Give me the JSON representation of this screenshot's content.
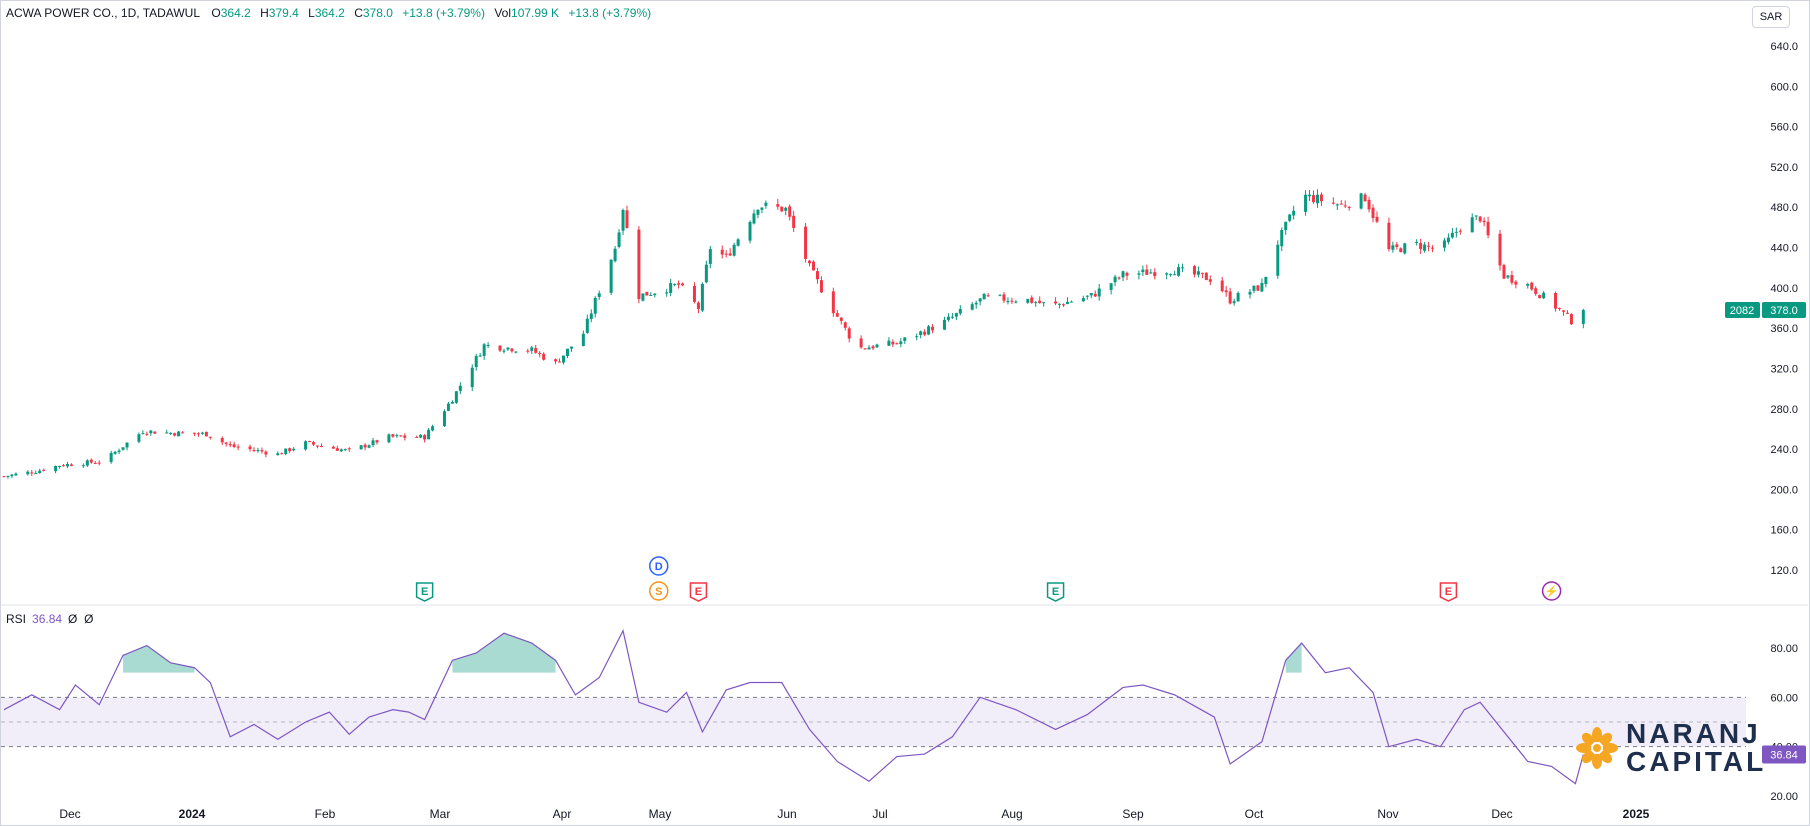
{
  "header": {
    "symbol": "ACWA POWER CO., 1D, TADAWUL",
    "open_label": "O",
    "open": "364.2",
    "high_label": "H",
    "high": "379.4",
    "low_label": "L",
    "low": "364.2",
    "close_label": "C",
    "close": "378.0",
    "change": "+13.8 (+3.79%)",
    "vol_label": "Vol",
    "vol": "107.99 K",
    "vol_change": "+13.8 (+3.79%)"
  },
  "currency": "SAR",
  "price_badges": {
    "countdown": "2082",
    "last": "378.0"
  },
  "rsi": {
    "label": "RSI",
    "value": "36.84",
    "extra1": "Ø",
    "extra2": "Ø"
  },
  "logo": {
    "line1": "NARANJ",
    "line2": "CAPITAL"
  },
  "colors": {
    "up": "#089981",
    "down": "#f23645",
    "rsi": "#7e57c2"
  },
  "chart_data": [
    {
      "type": "candlestick",
      "title": "ACWA POWER CO., 1D, TADAWUL",
      "x_tick_labels": [
        "Dec",
        "2024",
        "Feb",
        "Mar",
        "Apr",
        "May",
        "Jun",
        "Jul",
        "Aug",
        "Sep",
        "Oct",
        "Nov",
        "Dec",
        "2025"
      ],
      "y_tick_labels": [
        "640.0",
        "600.0",
        "560.0",
        "520.0",
        "480.0",
        "440.0",
        "400.0",
        "360.0",
        "320.0",
        "280.0",
        "240.0",
        "200.0",
        "160.0",
        "120.0"
      ],
      "ylim": [
        100,
        655
      ],
      "date_range": [
        "2023-11-20",
        "2024-12-01"
      ],
      "close_path": [
        {
          "t": "2023-11-20",
          "v": 213
        },
        {
          "t": "2023-11-28",
          "v": 218
        },
        {
          "t": "2023-12-04",
          "v": 224
        },
        {
          "t": "2023-12-15",
          "v": 228
        },
        {
          "t": "2023-12-25",
          "v": 258
        },
        {
          "t": "2024-01-01",
          "v": 256
        },
        {
          "t": "2024-01-10",
          "v": 255
        },
        {
          "t": "2024-01-16",
          "v": 243
        },
        {
          "t": "2024-01-28",
          "v": 235
        },
        {
          "t": "2024-02-04",
          "v": 246
        },
        {
          "t": "2024-02-15",
          "v": 238
        },
        {
          "t": "2024-02-25",
          "v": 252
        },
        {
          "t": "2024-03-05",
          "v": 252
        },
        {
          "t": "2024-03-12",
          "v": 290
        },
        {
          "t": "2024-03-20",
          "v": 343
        },
        {
          "t": "2024-04-01",
          "v": 338
        },
        {
          "t": "2024-04-07",
          "v": 325
        },
        {
          "t": "2024-04-14",
          "v": 355
        },
        {
          "t": "2024-04-22",
          "v": 440
        },
        {
          "t": "2024-04-24",
          "v": 480
        },
        {
          "t": "2024-04-28",
          "v": 392
        },
        {
          "t": "2024-05-08",
          "v": 403
        },
        {
          "t": "2024-05-13",
          "v": 380
        },
        {
          "t": "2024-05-16",
          "v": 440
        },
        {
          "t": "2024-05-20",
          "v": 430
        },
        {
          "t": "2024-05-28",
          "v": 482
        },
        {
          "t": "2024-06-04",
          "v": 478
        },
        {
          "t": "2024-06-10",
          "v": 420
        },
        {
          "t": "2024-06-16",
          "v": 378
        },
        {
          "t": "2024-06-22",
          "v": 340
        },
        {
          "t": "2024-07-02",
          "v": 345
        },
        {
          "t": "2024-07-14",
          "v": 366
        },
        {
          "t": "2024-07-24",
          "v": 390
        },
        {
          "t": "2024-08-04",
          "v": 388
        },
        {
          "t": "2024-08-10",
          "v": 382
        },
        {
          "t": "2024-08-20",
          "v": 392
        },
        {
          "t": "2024-08-28",
          "v": 413
        },
        {
          "t": "2024-09-10",
          "v": 418
        },
        {
          "t": "2024-09-20",
          "v": 408
        },
        {
          "t": "2024-09-24",
          "v": 388
        },
        {
          "t": "2024-10-02",
          "v": 402
        },
        {
          "t": "2024-10-06",
          "v": 445
        },
        {
          "t": "2024-10-12",
          "v": 492
        },
        {
          "t": "2024-10-22",
          "v": 482
        },
        {
          "t": "2024-10-28",
          "v": 490
        },
        {
          "t": "2024-11-03",
          "v": 437
        },
        {
          "t": "2024-11-10",
          "v": 443
        },
        {
          "t": "2024-11-16",
          "v": 438
        },
        {
          "t": "2024-11-22",
          "v": 465
        },
        {
          "t": "2024-11-26",
          "v": 470
        },
        {
          "t": "2024-12-02",
          "v": 412
        },
        {
          "t": "2024-12-08",
          "v": 403
        },
        {
          "t": "2024-12-14",
          "v": 385
        },
        {
          "t": "2024-12-20",
          "v": 364
        },
        {
          "t": "2024-12-22",
          "v": 378
        }
      ],
      "event_markers": [
        {
          "label": "E",
          "color": "#089981",
          "date": "2024-03-05"
        },
        {
          "label": "D",
          "color": "#2962ff",
          "date": "2024-05-03",
          "row": "upper"
        },
        {
          "label": "S",
          "color": "#f7931a",
          "date": "2024-05-03"
        },
        {
          "label": "E",
          "color": "#f23645",
          "date": "2024-05-13"
        },
        {
          "label": "E",
          "color": "#089981",
          "date": "2024-08-11"
        },
        {
          "label": "E",
          "color": "#f23645",
          "date": "2024-11-18"
        },
        {
          "label": "⚡",
          "color": "#9c27b0",
          "date": "2024-12-14"
        }
      ]
    },
    {
      "type": "line",
      "title": "RSI",
      "y_tick_labels": [
        "80.00",
        "60.00",
        "40.00",
        "20.00"
      ],
      "ylim": [
        17,
        93
      ],
      "bands": {
        "upper": 60,
        "middle": 50,
        "lower": 40
      },
      "last_value": "36.84",
      "series": [
        {
          "values": [
            {
              "t": "2023-11-20",
              "v": 55
            },
            {
              "t": "2023-11-27",
              "v": 61
            },
            {
              "t": "2023-12-04",
              "v": 55
            },
            {
              "t": "2023-12-08",
              "v": 65
            },
            {
              "t": "2023-12-14",
              "v": 57
            },
            {
              "t": "2023-12-20",
              "v": 77
            },
            {
              "t": "2023-12-26",
              "v": 81
            },
            {
              "t": "2024-01-01",
              "v": 74
            },
            {
              "t": "2024-01-07",
              "v": 72
            },
            {
              "t": "2024-01-11",
              "v": 66
            },
            {
              "t": "2024-01-16",
              "v": 44
            },
            {
              "t": "2024-01-22",
              "v": 49
            },
            {
              "t": "2024-01-28",
              "v": 43
            },
            {
              "t": "2024-02-04",
              "v": 50
            },
            {
              "t": "2024-02-10",
              "v": 54
            },
            {
              "t": "2024-02-15",
              "v": 45
            },
            {
              "t": "2024-02-20",
              "v": 52
            },
            {
              "t": "2024-02-26",
              "v": 55
            },
            {
              "t": "2024-03-01",
              "v": 54
            },
            {
              "t": "2024-03-05",
              "v": 51
            },
            {
              "t": "2024-03-12",
              "v": 75
            },
            {
              "t": "2024-03-18",
              "v": 78
            },
            {
              "t": "2024-03-25",
              "v": 86
            },
            {
              "t": "2024-04-01",
              "v": 82
            },
            {
              "t": "2024-04-07",
              "v": 75
            },
            {
              "t": "2024-04-12",
              "v": 61
            },
            {
              "t": "2024-04-18",
              "v": 68
            },
            {
              "t": "2024-04-24",
              "v": 87
            },
            {
              "t": "2024-04-28",
              "v": 58
            },
            {
              "t": "2024-05-05",
              "v": 54
            },
            {
              "t": "2024-05-10",
              "v": 62
            },
            {
              "t": "2024-05-14",
              "v": 46
            },
            {
              "t": "2024-05-20",
              "v": 63
            },
            {
              "t": "2024-05-26",
              "v": 66
            },
            {
              "t": "2024-06-03",
              "v": 66
            },
            {
              "t": "2024-06-10",
              "v": 47
            },
            {
              "t": "2024-06-17",
              "v": 34
            },
            {
              "t": "2024-06-25",
              "v": 26
            },
            {
              "t": "2024-07-02",
              "v": 36
            },
            {
              "t": "2024-07-09",
              "v": 37
            },
            {
              "t": "2024-07-16",
              "v": 44
            },
            {
              "t": "2024-07-23",
              "v": 60
            },
            {
              "t": "2024-08-01",
              "v": 55
            },
            {
              "t": "2024-08-11",
              "v": 47
            },
            {
              "t": "2024-08-19",
              "v": 53
            },
            {
              "t": "2024-08-28",
              "v": 64
            },
            {
              "t": "2024-09-02",
              "v": 65
            },
            {
              "t": "2024-09-10",
              "v": 61
            },
            {
              "t": "2024-09-20",
              "v": 52
            },
            {
              "t": "2024-09-24",
              "v": 33
            },
            {
              "t": "2024-10-02",
              "v": 42
            },
            {
              "t": "2024-10-08",
              "v": 75
            },
            {
              "t": "2024-10-12",
              "v": 82
            },
            {
              "t": "2024-10-18",
              "v": 70
            },
            {
              "t": "2024-10-24",
              "v": 72
            },
            {
              "t": "2024-10-30",
              "v": 62
            },
            {
              "t": "2024-11-03",
              "v": 40
            },
            {
              "t": "2024-11-10",
              "v": 43
            },
            {
              "t": "2024-11-16",
              "v": 40
            },
            {
              "t": "2024-11-22",
              "v": 55
            },
            {
              "t": "2024-11-26",
              "v": 58
            },
            {
              "t": "2024-12-02",
              "v": 46
            },
            {
              "t": "2024-12-08",
              "v": 34
            },
            {
              "t": "2024-12-14",
              "v": 32
            },
            {
              "t": "2024-12-20",
              "v": 25
            },
            {
              "t": "2024-12-22",
              "v": 36.84
            }
          ]
        }
      ]
    }
  ]
}
